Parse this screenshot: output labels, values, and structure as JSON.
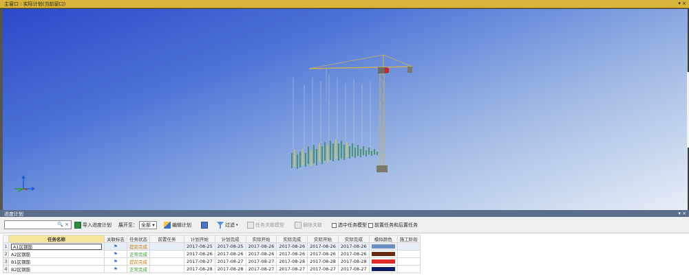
{
  "top_bar": {
    "title": "主窗口 : 实际计划(当前窗口)",
    "pin": "▾ ×"
  },
  "panel_bar": {
    "title": "进度计划",
    "pin": "▾ ×"
  },
  "toolbar": {
    "search_placeholder": "",
    "search_icons": "🔍 ×",
    "import_label": "导入进度计划",
    "expand_label": "展开至：",
    "expand_value": "全部",
    "edit_plan_label": "编辑计划",
    "filter_label": "过滤",
    "assoc_model_label": "任务关联模型",
    "remove_assoc_label": "解除关联",
    "only_current_task_label": "选中任务模型",
    "prev_next_task_label": "前置任务和后置任务"
  },
  "table": {
    "headers": [
      "任务名称",
      "关联标志",
      "任务状态",
      "前置任务",
      "计划开始",
      "计划完成",
      "实际开始",
      "实际完成",
      "实际开始",
      "实际完成",
      "模拟颜色",
      "施工阶段"
    ],
    "rows": [
      {
        "num": "1",
        "name": "A1区钢筋",
        "flag": "⚑",
        "status": "提前完成",
        "pred": "",
        "c1": "2017-08-25",
        "c2": "2017-08-25",
        "c3": "2017-08-26",
        "c4": "2017-08-26",
        "c5": "2017-08-26",
        "c6": "2017-08-26",
        "color": "#6d8fbf",
        "phase": ""
      },
      {
        "num": "2",
        "name": "A2区钢筋",
        "flag": "⚑",
        "status": "正常完成",
        "pred": "",
        "c1": "2017-08-26",
        "c2": "2017-08-26",
        "c3": "2017-08-26",
        "c4": "2017-08-26",
        "c5": "2017-08-26",
        "c6": "2017-08-26",
        "color": "#6a2a12",
        "phase": ""
      },
      {
        "num": "3",
        "name": "B1区钢筋",
        "flag": "⚑",
        "status": "提前完成",
        "pred": "",
        "c1": "2017-08-27",
        "c2": "2017-08-27",
        "c3": "2017-08-27",
        "c4": "2017-08-28",
        "c5": "2017-08-28",
        "c6": "2017-08-28",
        "color": "#e32b2b",
        "phase": ""
      },
      {
        "num": "4",
        "name": "B2区钢筋",
        "flag": "⚑",
        "status": "正常完成",
        "pred": "",
        "c1": "2017-08-28",
        "c2": "2017-08-28",
        "c3": "2017-08-27",
        "c4": "2017-08-27",
        "c5": "2017-08-27",
        "c6": "2017-08-27",
        "color": "#0e1f66",
        "phase": ""
      }
    ]
  }
}
